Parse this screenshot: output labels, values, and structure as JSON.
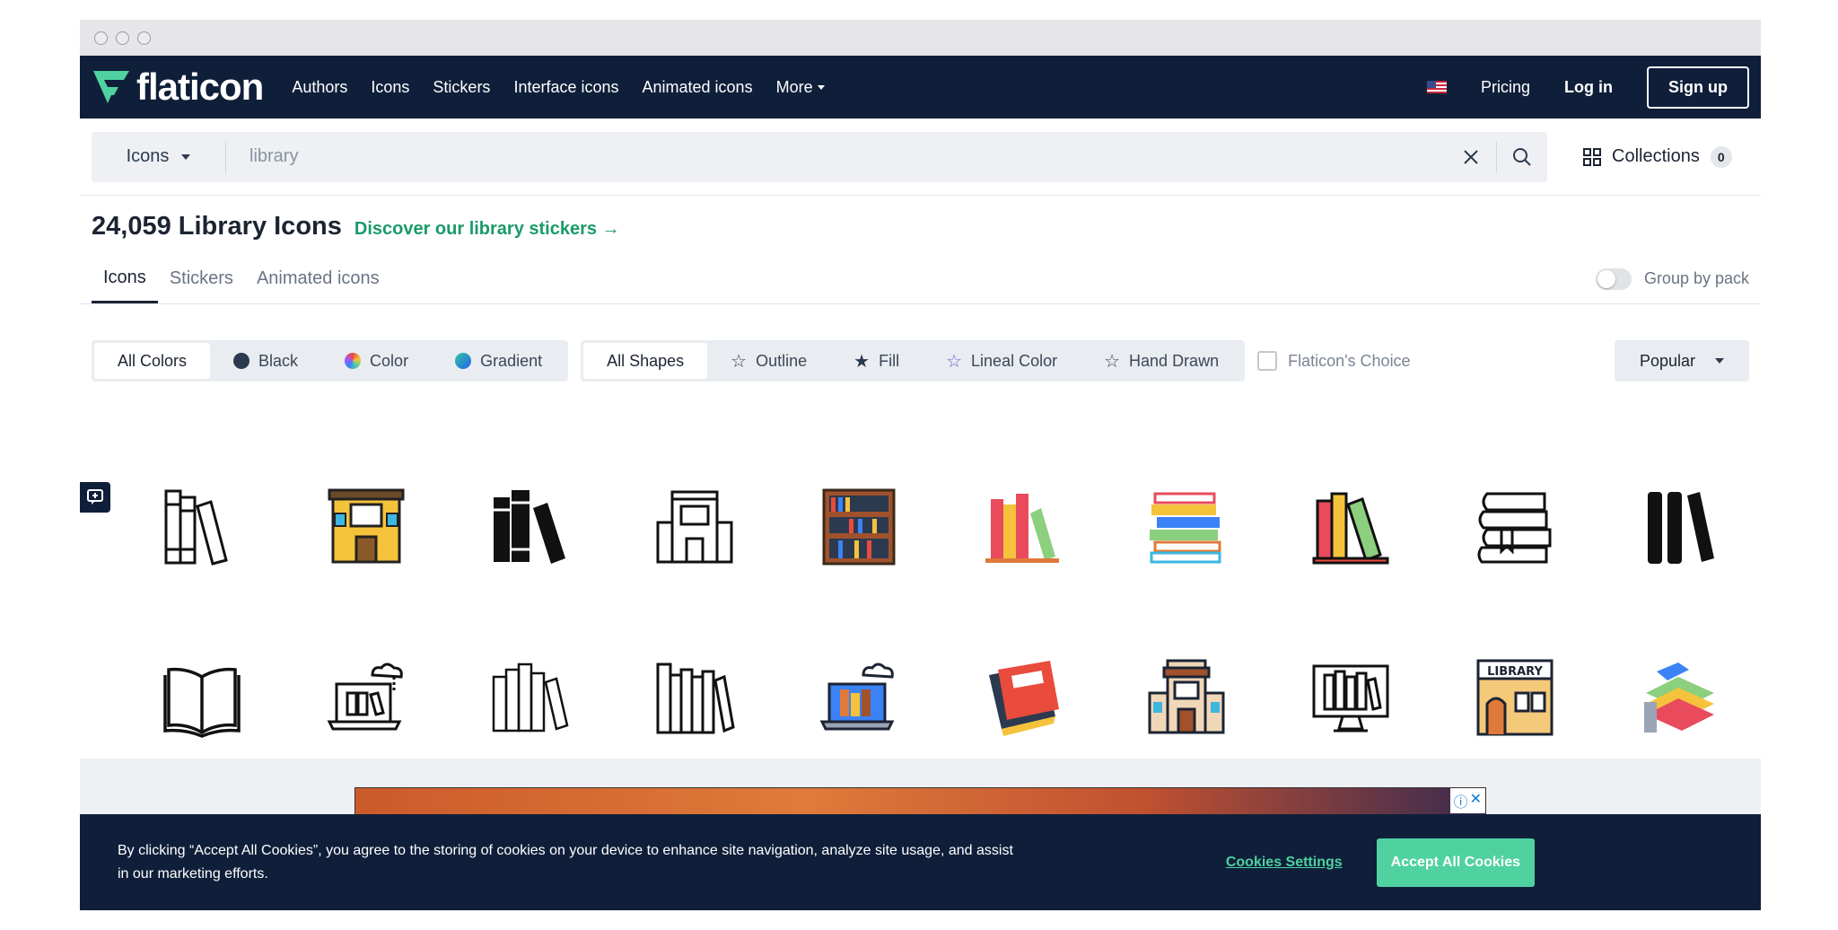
{
  "nav": {
    "logo_text": "flaticon",
    "links": [
      "Authors",
      "Icons",
      "Stickers",
      "Interface icons",
      "Animated icons",
      "More"
    ],
    "pricing": "Pricing",
    "login": "Log in",
    "signup": "Sign up"
  },
  "search": {
    "type": "Icons",
    "placeholder": "library",
    "collections": "Collections",
    "collections_count": "0"
  },
  "heading": {
    "title": "24,059 Library Icons",
    "discover": "Discover our library stickers"
  },
  "tabs": [
    "Icons",
    "Stickers",
    "Animated icons"
  ],
  "group_by_pack": "Group by pack",
  "filters": {
    "colors": [
      "All Colors",
      "Black",
      "Color",
      "Gradient"
    ],
    "shapes": [
      "All Shapes",
      "Outline",
      "Fill",
      "Lineal Color",
      "Hand Drawn"
    ],
    "choice": "Flaticon's Choice",
    "sort": "Popular"
  },
  "icons": [
    "books-outline-icon",
    "library-building-color-icon",
    "books-fill-icon",
    "library-building-outline-icon",
    "bookshelf-color-icon",
    "books-flat-color-icon",
    "book-stack-color-icon",
    "books-lineal-color-icon",
    "book-stack-outline-icon",
    "books-glyph-icon",
    "open-book-icon",
    "online-library-outline-icon",
    "books-outline-thin-icon",
    "books-shelf-outline-icon",
    "online-library-color-icon",
    "red-book-icon",
    "library-building-flat-icon",
    "computer-library-icon",
    "library-storefront-icon",
    "books-isometric-icon"
  ],
  "cookie": {
    "text": "By clicking “Accept All Cookies”, you agree to the storing of cookies on your device to enhance site navigation, analyze site usage, and assist in our marketing efforts.",
    "settings": "Cookies Settings",
    "accept": "Accept All Cookies"
  },
  "colors": {
    "nav_bg": "#0f1f3a",
    "accent_green": "#1a9a6a",
    "cookie_button": "#4fd1a0"
  }
}
